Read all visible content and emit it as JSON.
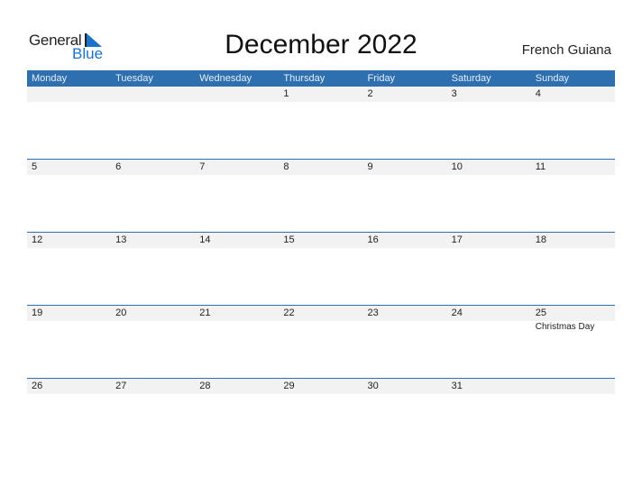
{
  "logo": {
    "general": "General",
    "blue": "Blue",
    "icon": "triangle-flag-icon"
  },
  "title": "December 2022",
  "country": "French Guiana",
  "colors": {
    "accent": "#2e6fb0",
    "stripe": "#f2f2f2",
    "logo_blue": "#1a73c9"
  },
  "weekdays": [
    "Monday",
    "Tuesday",
    "Wednesday",
    "Thursday",
    "Friday",
    "Saturday",
    "Sunday"
  ],
  "weeks": [
    [
      {
        "day": ""
      },
      {
        "day": ""
      },
      {
        "day": ""
      },
      {
        "day": "1"
      },
      {
        "day": "2"
      },
      {
        "day": "3"
      },
      {
        "day": "4"
      }
    ],
    [
      {
        "day": "5"
      },
      {
        "day": "6"
      },
      {
        "day": "7"
      },
      {
        "day": "8"
      },
      {
        "day": "9"
      },
      {
        "day": "10"
      },
      {
        "day": "11"
      }
    ],
    [
      {
        "day": "12"
      },
      {
        "day": "13"
      },
      {
        "day": "14"
      },
      {
        "day": "15"
      },
      {
        "day": "16"
      },
      {
        "day": "17"
      },
      {
        "day": "18"
      }
    ],
    [
      {
        "day": "19"
      },
      {
        "day": "20"
      },
      {
        "day": "21"
      },
      {
        "day": "22"
      },
      {
        "day": "23"
      },
      {
        "day": "24"
      },
      {
        "day": "25",
        "event": "Christmas Day"
      }
    ],
    [
      {
        "day": "26"
      },
      {
        "day": "27"
      },
      {
        "day": "28"
      },
      {
        "day": "29"
      },
      {
        "day": "30"
      },
      {
        "day": "31"
      },
      {
        "day": ""
      }
    ]
  ]
}
